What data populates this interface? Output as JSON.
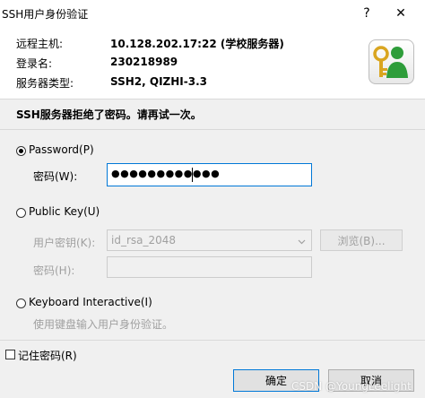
{
  "window": {
    "title": "SSH用户身份验证",
    "help_glyph": "?",
    "close_glyph": "✕"
  },
  "info": {
    "host_label": "远程主机:",
    "host_value": "10.128.202.17:22 (学校服务器)",
    "login_label": "登录名:",
    "login_value": "230218989",
    "server_type_label": "服务器类型:",
    "server_type_value": "SSH2, QIZHI-3.3"
  },
  "message": "SSH服务器拒绝了密码。请再试一次。",
  "password_option": {
    "label": "Password(P)",
    "checked": true,
    "field_label": "密码(W):",
    "field_value": "●●●●●●●●●●●●"
  },
  "publickey_option": {
    "label": "Public Key(U)",
    "checked": false,
    "key_label": "用户密钥(K):",
    "key_value": "id_rsa_2048",
    "browse_label": "浏览(B)...",
    "passphrase_label": "密码(H):"
  },
  "keyboard_option": {
    "label": "Keyboard Interactive(I)",
    "checked": false,
    "description": "使用键盘输入用户身份验证。"
  },
  "remember_password_label": "记住密码(R)",
  "buttons": {
    "ok": "确定",
    "cancel": "取消"
  },
  "watermark": "CSDN @YoungLeelight",
  "colors": {
    "focus_blue": "#0078d7",
    "key_icon_green": "#2e9d3a",
    "key_icon_gold": "#d9a520"
  },
  "icons": {
    "auth_icon": "key-person-icon",
    "dropdown": "chevron-down-icon"
  }
}
